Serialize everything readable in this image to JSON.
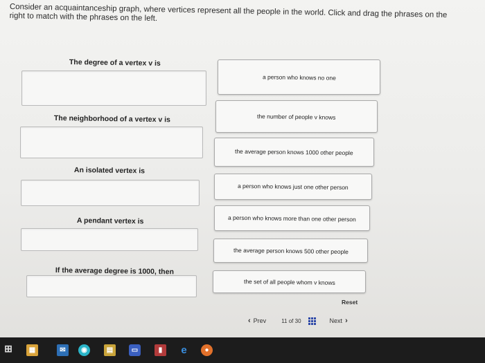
{
  "instructions": "Consider an acquaintanceship graph, where vertices represent all the people in the world. Click and drag the phrases on the right to match with the phrases on the left.",
  "prompts": [
    "The degree of a vertex v is",
    "The neighborhood of a vertex v is",
    "An isolated vertex is",
    "A pendant vertex is",
    "If the average degree is 1000, then"
  ],
  "phrases": [
    "a person who knows no one",
    "the number of people v knows",
    "the average person knows 1000 other people",
    "a person who knows just one other person",
    "a person who knows more than one other person",
    "the average person knows 500 other people",
    "the set of all people whom v knows"
  ],
  "controls": {
    "reset": "Reset",
    "prev": "Prev",
    "next": "Next",
    "page_current": "11",
    "page_of": "of",
    "page_total": "30"
  },
  "taskbar": {
    "icons": [
      "windows-start-icon",
      "store-icon",
      "mail-icon",
      "messenger-icon",
      "files-icon",
      "mcgraw-hill-icon",
      "news-icon",
      "edge-icon",
      "firefox-icon"
    ]
  },
  "colors": {
    "accent_blue": "#2f4aa8",
    "taskbar": "#1c1c1c"
  }
}
